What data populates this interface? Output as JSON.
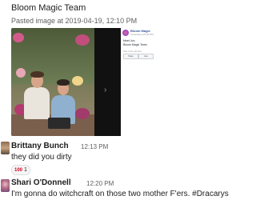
{
  "channel_post": {
    "title": "Bloom Magic Team",
    "caption": "Pasted image at 2019-04-19, 12:10 PM",
    "caption_dropdown_icon": "chevron-down-icon",
    "image_icon": "photo-icon"
  },
  "embedded_card": {
    "page_name": "Bloom Magic",
    "subline": "Yesterday at 8:30 PM",
    "lines": [
      "Meet Jon,",
      "Bloom Magic Team"
    ],
    "more_text": "See more photos",
    "buttons": [
      "Share",
      "Like"
    ]
  },
  "messages": [
    {
      "sender": "Brittany Bunch",
      "time": "12:13 PM",
      "text": "they did you dirty",
      "avatar_icon": "avatar-icon",
      "reaction": {
        "emoji": "100",
        "count": "1",
        "icon": "hundred-points-icon"
      }
    },
    {
      "sender": "Shari O'Donnell",
      "time": "12:20 PM",
      "text": "I'm gonna do witchcraft on those two mother F'ers. #Dracarys",
      "avatar_icon": "avatar-icon"
    }
  ],
  "colors": {
    "text": "#1d1c1d",
    "muted": "#616061",
    "link": "#385898",
    "reaction_red": "#d0021b"
  }
}
